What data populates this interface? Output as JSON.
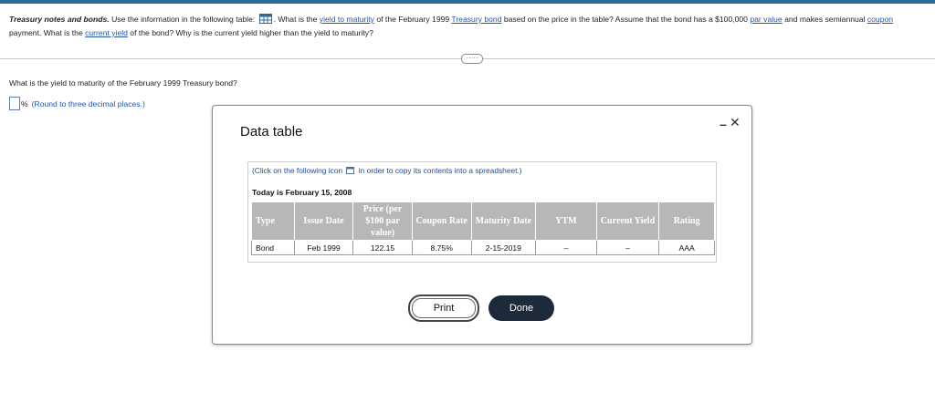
{
  "question": {
    "title": "Treasury notes and bonds.",
    "part1": " Use the information in the following table: ",
    "part2": ". What is the ",
    "link_ytm": "yield to maturity",
    "part3": " of the February 1999 ",
    "link_bond": "Treasury bond",
    "part4": " based on the price in the table? Assume that the bond has a $100,000 ",
    "link_par": "par value",
    "part5": " and makes semiannual ",
    "link_coupon": "coupon",
    "part6": " payment. What is the ",
    "link_cy": "current yield",
    "part7": " of the bond? Why is the current yield higher than the yield to maturity?"
  },
  "expander_label": "·····",
  "sub_question": "What is the yield to maturity of the February 1999 Treasury bond?",
  "answer": {
    "value": "",
    "unit": "%",
    "note": "(Round to three decimal places.)"
  },
  "modal": {
    "title": "Data table",
    "minimize_label": "–",
    "close_label": "✕",
    "copy_note_pre": "(Click on the following icon ",
    "copy_note_post": " in order to copy its contents into a spreadsheet.)",
    "today": "Today is February 15, 2008",
    "headers": [
      "Type",
      "Issue Date",
      "Price (per $100 par value)",
      "Coupon Rate",
      "Maturity Date",
      "YTM",
      "Current Yield",
      "Rating"
    ],
    "rows": [
      [
        "Bond",
        "Feb 1999",
        "122.15",
        "8.75%",
        "2-15-2019",
        "–",
        "–",
        "AAA"
      ]
    ],
    "print_label": "Print",
    "done_label": "Done"
  },
  "colors": {
    "accent": "#2d6a96",
    "link": "#2255aa",
    "header_bg": "#b7b7b7",
    "done_bg": "#1c2a3a"
  }
}
